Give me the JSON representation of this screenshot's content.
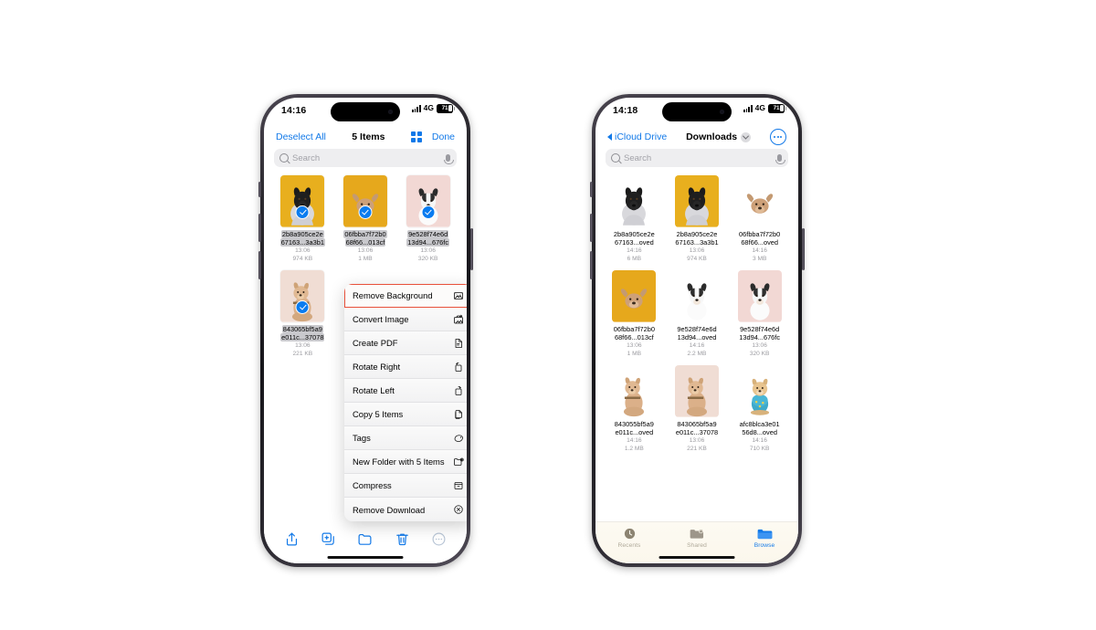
{
  "left_phone": {
    "status": {
      "time": "14:16",
      "network": "4G",
      "battery": "71"
    },
    "navbar": {
      "left_label": "Deselect All",
      "title": "5 Items",
      "right_label": "Done",
      "view_icon": "grid-view-icon"
    },
    "search": {
      "placeholder": "Search",
      "search_icon": "search-icon",
      "mic_icon": "microphone-icon"
    },
    "files": [
      {
        "name1": "2b8a905ce2e",
        "name2": "67163...3a3b1",
        "time": "13:06",
        "size": "974 KB",
        "selected": true,
        "art": "dog-black-yellow"
      },
      {
        "name1": "06fbba7f72b0",
        "name2": "68f66...013cf",
        "time": "13:06",
        "size": "1 MB",
        "selected": true,
        "art": "dog-frenchie-yellow"
      },
      {
        "name1": "9e528f74e6d",
        "name2": "13d94...676fc",
        "time": "13:06",
        "size": "320 KB",
        "selected": true,
        "art": "dog-jack-pink"
      },
      {
        "name1": "843065bf5a9",
        "name2": "e011c...37078",
        "time": "13:06",
        "size": "221 KB",
        "selected": true,
        "art": "dog-puppy-tan"
      }
    ],
    "menu": {
      "items": [
        {
          "label": "Remove Background",
          "icon": "remove-background-icon",
          "highlighted": true
        },
        {
          "label": "Convert Image",
          "icon": "convert-image-icon",
          "highlighted": false
        },
        {
          "label": "Create PDF",
          "icon": "create-pdf-icon",
          "highlighted": false
        },
        {
          "label": "Rotate Right",
          "icon": "rotate-right-icon",
          "highlighted": false
        },
        {
          "label": "Rotate Left",
          "icon": "rotate-left-icon",
          "highlighted": false
        },
        {
          "label": "Copy 5 Items",
          "icon": "copy-icon",
          "highlighted": false
        },
        {
          "label": "Tags",
          "icon": "tag-icon",
          "highlighted": false
        },
        {
          "label": "New Folder with 5 Items",
          "icon": "new-folder-icon",
          "highlighted": false
        },
        {
          "label": "Compress",
          "icon": "compress-icon",
          "highlighted": false
        },
        {
          "label": "Remove Download",
          "icon": "remove-download-icon",
          "highlighted": false
        }
      ]
    },
    "toolbar": [
      {
        "icon": "share-icon",
        "dim": false
      },
      {
        "icon": "duplicate-icon",
        "dim": false
      },
      {
        "icon": "folder-icon",
        "dim": false
      },
      {
        "icon": "trash-icon",
        "dim": false
      },
      {
        "icon": "more-ellipsis-icon",
        "dim": true
      }
    ]
  },
  "right_phone": {
    "status": {
      "time": "14:18",
      "network": "4G",
      "battery": "71"
    },
    "navbar": {
      "back_label": "iCloud Drive",
      "title": "Downloads",
      "back_icon": "chevron-left-icon",
      "dropdown_icon": "chevron-down-icon",
      "more_icon": "more-ellipsis-circle-icon"
    },
    "search": {
      "placeholder": "Search",
      "search_icon": "search-icon",
      "mic_icon": "microphone-icon"
    },
    "files": [
      {
        "name1": "2b8a905ce2e",
        "name2": "67163...oved",
        "time": "14:16",
        "size": "6 MB",
        "art": "dog-black-white"
      },
      {
        "name1": "2b8a905ce2e",
        "name2": "67163...3a3b1",
        "time": "13:06",
        "size": "974 KB",
        "art": "dog-black-yellow"
      },
      {
        "name1": "06fbba7f72b0",
        "name2": "68f66...oved",
        "time": "14:16",
        "size": "3 MB",
        "art": "dog-frenchie-white"
      },
      {
        "name1": "06fbba7f72b0",
        "name2": "68f66...013cf",
        "time": "13:06",
        "size": "1 MB",
        "art": "dog-frenchie-yellow"
      },
      {
        "name1": "9e528f74e6d",
        "name2": "13d94...oved",
        "time": "14:16",
        "size": "2.2 MB",
        "art": "dog-jack-white"
      },
      {
        "name1": "9e528f74e6d",
        "name2": "13d94...676fc",
        "time": "13:06",
        "size": "320 KB",
        "art": "dog-jack-pink"
      },
      {
        "name1": "843055bf5a9",
        "name2": "e011c...oved",
        "time": "14:16",
        "size": "1.2 MB",
        "art": "dog-puppy-white"
      },
      {
        "name1": "843065bf5a9",
        "name2": "e011c...37078",
        "time": "13:06",
        "size": "221 KB",
        "art": "dog-puppy-tan"
      },
      {
        "name1": "afc8blca3e01",
        "name2": "56d8...oved",
        "time": "14:16",
        "size": "710 KB",
        "art": "dog-sweater-white"
      }
    ],
    "tabs": [
      {
        "label": "Recents",
        "icon": "clock-icon",
        "active": false
      },
      {
        "label": "Shared",
        "icon": "shared-folder-icon",
        "active": false
      },
      {
        "label": "Browse",
        "icon": "folder-icon",
        "active": true
      }
    ]
  },
  "colors": {
    "accent": "#1279e8",
    "select_blue": "#0a7cf0",
    "highlight_border": "#e8503a",
    "page_background": "#ffffff"
  }
}
